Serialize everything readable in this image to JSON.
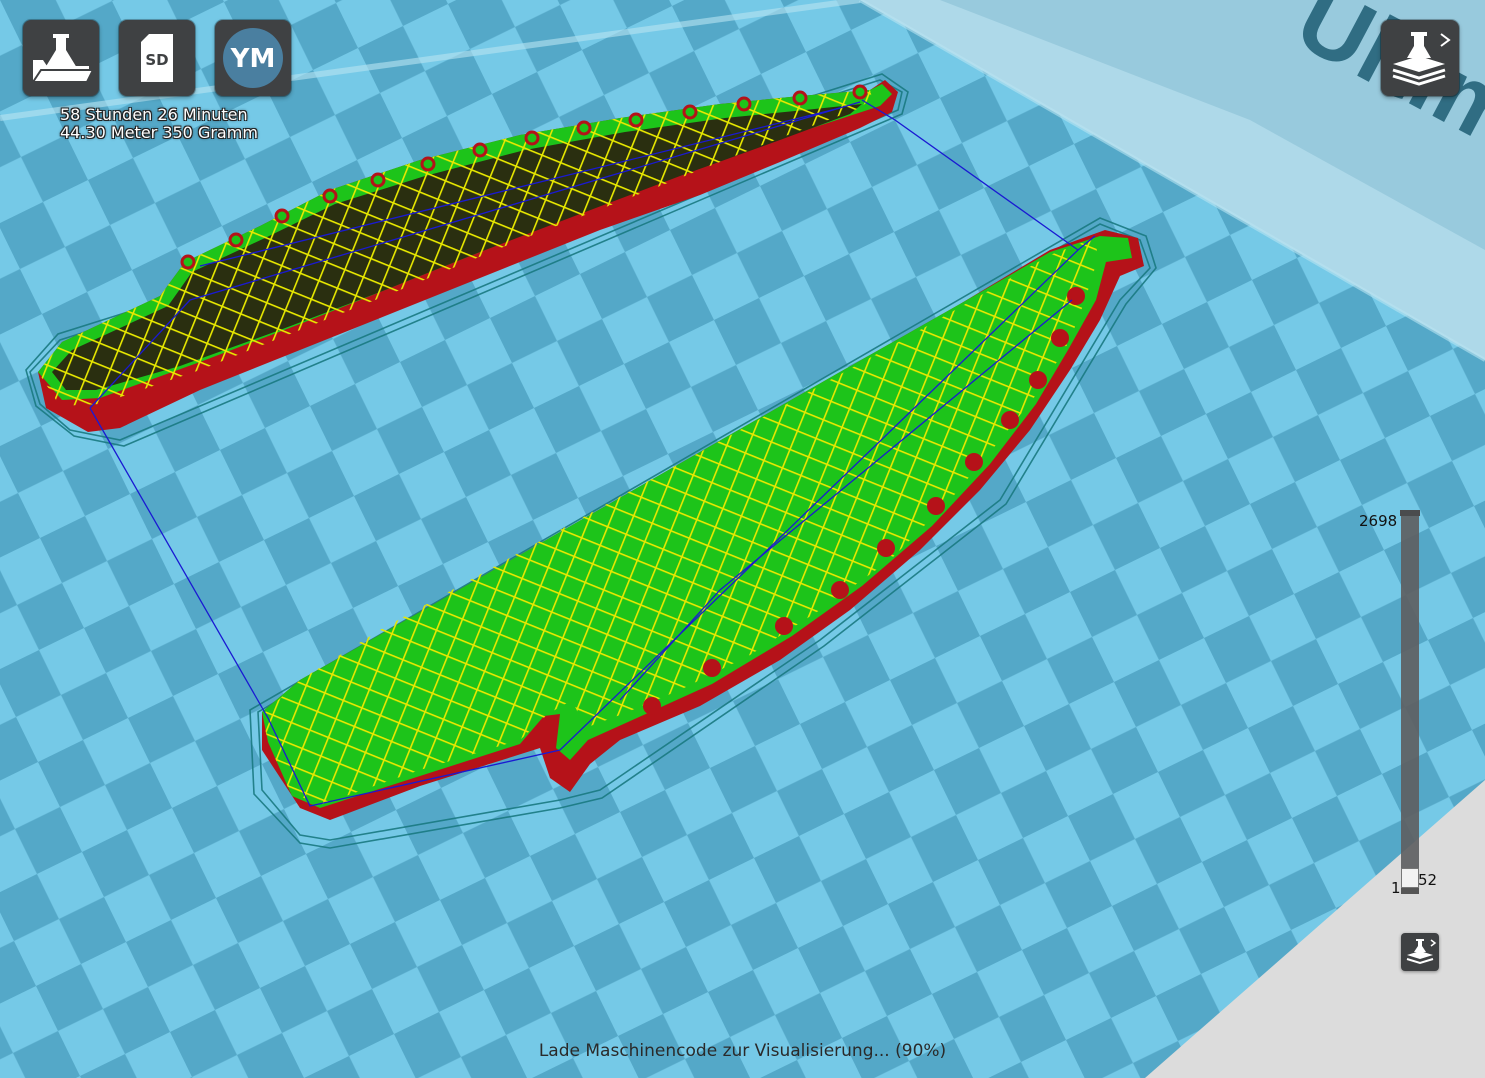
{
  "toolbar": {
    "buttons": [
      {
        "name": "open-file-button",
        "icon": "open-file-icon"
      },
      {
        "name": "save-to-sd-button",
        "icon": "sd-card-icon",
        "label": "SD"
      },
      {
        "name": "youmagine-button",
        "icon": "youmagine-icon",
        "label": "YM"
      }
    ]
  },
  "print_info": {
    "time": "58 Stunden 26 Minuten",
    "material": "44.30 Meter 350 Gramm"
  },
  "layer_slider": {
    "max_label": "2698",
    "min_label": "1",
    "current_label": "52",
    "max_layer": 2698,
    "current_layer": 52
  },
  "status": {
    "message": "Lade Maschinencode zur Visualisierung... (90%)"
  },
  "scene": {
    "watermark_text": "Ultimaker",
    "colors": {
      "build_plate_light": "#74c8e6",
      "build_plate_dark": "#53a6c6",
      "background": "#dcdcdc",
      "wall_outer": "#c8141a",
      "wall_inner": "#1fc81a",
      "infill": "#e6e600",
      "skirt": "#1a7a82",
      "travel": "#1a1ad2",
      "button_bg": "#3f4143"
    }
  }
}
